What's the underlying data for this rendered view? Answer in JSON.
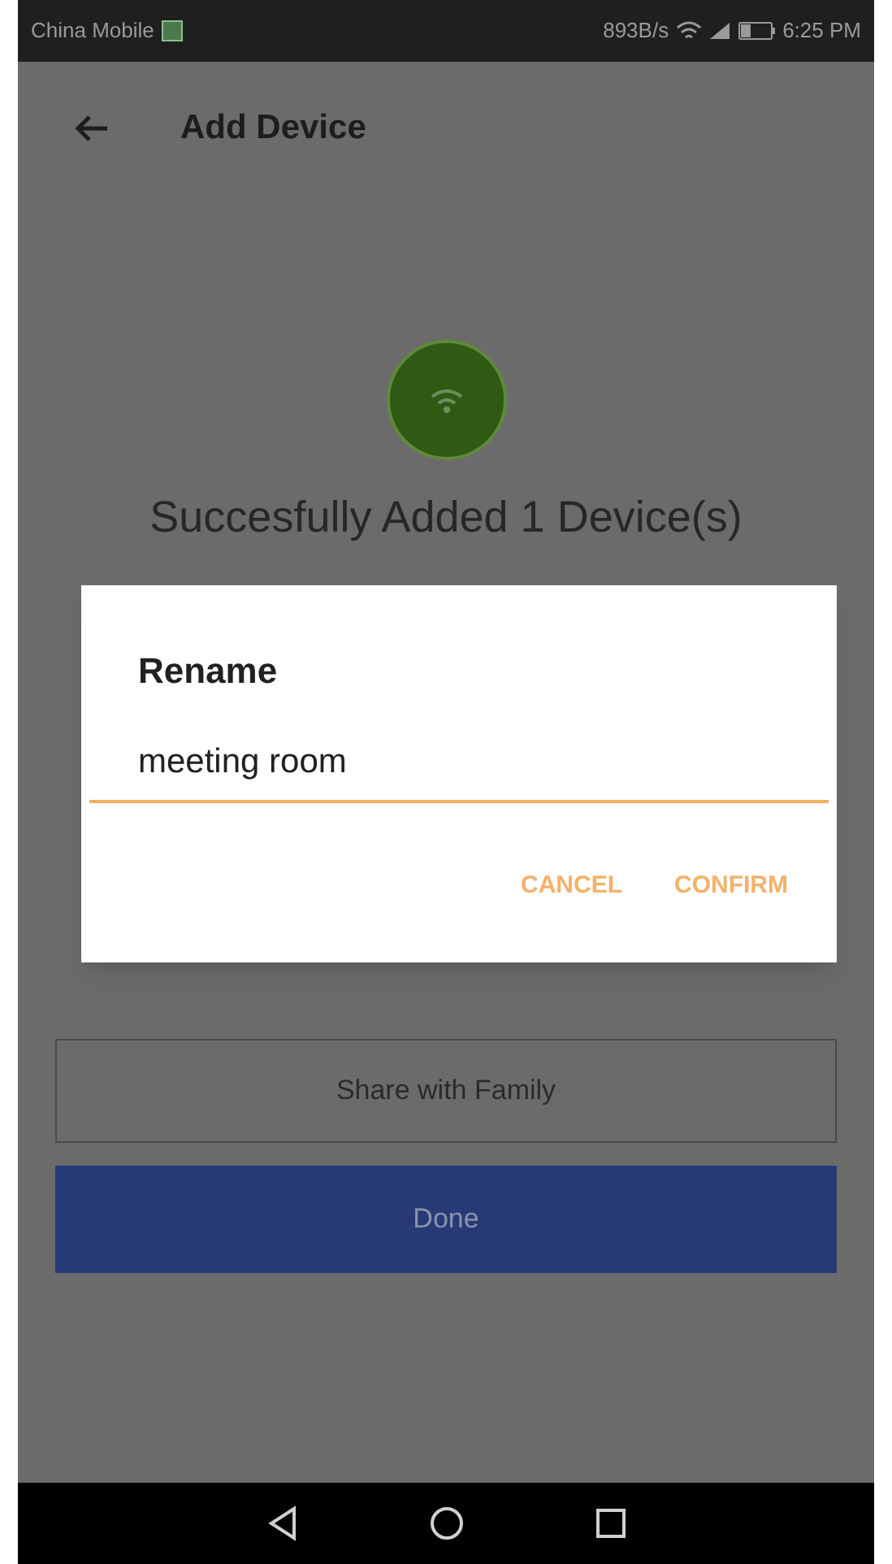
{
  "status_bar": {
    "carrier": "China Mobile",
    "speed": "893B/s",
    "time": "6:25 PM"
  },
  "header": {
    "title": "Add Device"
  },
  "message": "Succesfully Added 1 Device(s)",
  "buttons": [
    {
      "label": "Share with Family",
      "kind": "outline"
    },
    {
      "label": "Done",
      "kind": "filled"
    }
  ],
  "dialog": {
    "title": "Rename",
    "value": "meeting room",
    "actions": [
      "CANCEL",
      "CONFIRM"
    ]
  }
}
